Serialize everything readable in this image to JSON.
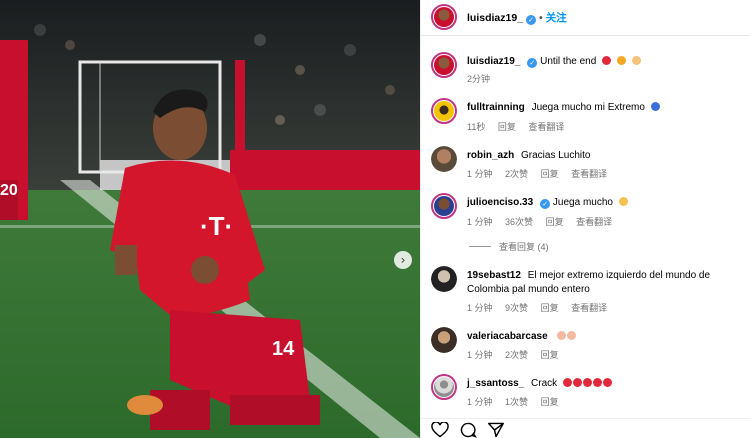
{
  "post": {
    "username": "luisdiaz19_",
    "follow_label": "关注",
    "separator": "•"
  },
  "comments": [
    {
      "username": "luisdiaz19_",
      "text": "Until the end",
      "time": "2分钟",
      "likes": "",
      "reply_label": "",
      "translate_label": "",
      "emojis": [
        "#e0293a",
        "#f5a623",
        "#f4c27a"
      ]
    },
    {
      "username": "fulltrainning",
      "text": "Juega mucho mi Extremo",
      "time": "11秒",
      "likes": "",
      "reply_label": "回复",
      "translate_label": "查看翻译",
      "emojis": [
        "#3b6fd8"
      ]
    },
    {
      "username": "robin_azh",
      "text": "Gracias Luchito",
      "time": "1 分钟",
      "likes": "2次赞",
      "reply_label": "回复",
      "translate_label": "查看翻译",
      "emojis": []
    },
    {
      "username": "julioenciso.33",
      "text": "Juega mucho",
      "time": "1 分钟",
      "likes": "36次赞",
      "reply_label": "回复",
      "translate_label": "查看翻译",
      "emojis": [
        "#f2c14e"
      ]
    },
    {
      "username": "19sebast12",
      "text": "El mejor extremo izquierdo del mundo de Colombia pal mundo entero",
      "time": "1 分钟",
      "likes": "9次赞",
      "reply_label": "回复",
      "translate_label": "查看翻译",
      "emojis": []
    },
    {
      "username": "valeriacabarcase",
      "text": "",
      "time": "1 分钟",
      "likes": "2次赞",
      "reply_label": "回复",
      "translate_label": "",
      "emojis": [
        "#f4b9a0",
        "#f4b9a0"
      ]
    },
    {
      "username": "j_ssantoss_",
      "text": "Crack",
      "time": "1 分钟",
      "likes": "1次赞",
      "reply_label": "回复",
      "translate_label": "",
      "emojis": [
        "#e0293a",
        "#e0293a",
        "#e0293a",
        "#e0293a",
        "#e0293a"
      ]
    }
  ],
  "view_replies": "查看回复 (4)",
  "icons": {
    "like": "heart-icon",
    "comment": "comment-icon",
    "share": "share-icon",
    "next": "chevron-right-icon"
  },
  "colors": {
    "accent": "#0095f6",
    "verified": "#3897f0",
    "jersey": "#d3162c"
  }
}
